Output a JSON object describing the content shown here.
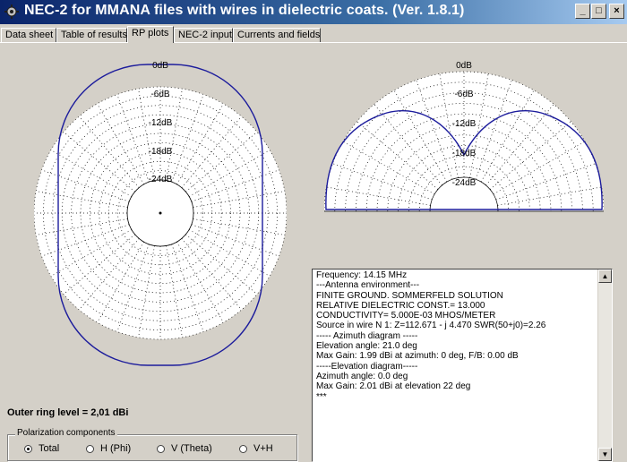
{
  "window": {
    "title": "NEC-2 for MMANA files with wires in dielectric coats. (Ver. 1.8.1)",
    "minimize_glyph": "_",
    "maximize_glyph": "□",
    "close_glyph": "×",
    "title_icon": "gear-icon"
  },
  "tabs": [
    {
      "label": "Data sheet"
    },
    {
      "label": "Table of results"
    },
    {
      "label": "RP plots",
      "active": true
    },
    {
      "label": "NEC-2 input"
    },
    {
      "label": "Currents and fields"
    }
  ],
  "azimuth_plot": {
    "ring_labels": [
      "0dB",
      "-6dB",
      "-12dB",
      "-18dB",
      "-24dB"
    ]
  },
  "elevation_plot": {
    "ring_labels": [
      "0dB",
      "-6dB",
      "-12dB",
      "-18dB",
      "-24dB"
    ]
  },
  "info": {
    "lines": [
      "Frequency:  14.15  MHz",
      "---Antenna environment---",
      "FINITE GROUND.  SOMMERFELD SOLUTION",
      "RELATIVE DIELECTRIC CONST.= 13.000",
      "CONDUCTIVITY= 5.000E-03 MHOS/METER",
      "Source in wire N 1:      Z=112.671 - j 4.470   SWR(50+j0)=2.26",
      "----- Azimuth diagram -----",
      "Elevation angle: 21.0 deg",
      "Max Gain: 1.99 dBi  at azimuth: 0 deg,  F/B: 0.00 dB",
      "-----Elevation diagram-----",
      "Azimuth angle: 0.0 deg",
      "Max Gain: 2.01 dBi at elevation  22 deg",
      "***"
    ],
    "scroll_up_glyph": "▲",
    "scroll_down_glyph": "▼"
  },
  "outer_ring_text": "Outer ring level = 2,01 dBi",
  "polarization": {
    "legend": "Polarization components",
    "options": [
      {
        "label": "Total",
        "checked": true
      },
      {
        "label": "H (Phi)",
        "checked": false
      },
      {
        "label": "V (Theta)",
        "checked": false
      },
      {
        "label": "V+H",
        "checked": false
      }
    ]
  },
  "colors": {
    "pattern": "#1c1c9c",
    "grid_dot": "#000000",
    "plot_bg": "#ffffff"
  }
}
